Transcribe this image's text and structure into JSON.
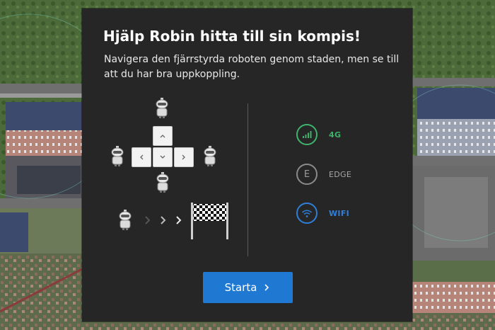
{
  "dialog": {
    "title": "Hjälp Robin hitta till sin kompis!",
    "description": "Navigera den fjärrstyrda roboten genom staden, men se till att du har bra uppkoppling."
  },
  "controls": {
    "icons": [
      "robot-icon",
      "chevron-up-icon",
      "chevron-left-icon",
      "chevron-down-icon",
      "chevron-right-icon",
      "checkered-flag-icon"
    ]
  },
  "network": [
    {
      "id": "4g",
      "label": "4G",
      "icon": "signal-bars-icon",
      "color": "#3fb26b",
      "symbol": ""
    },
    {
      "id": "edge",
      "label": "EDGE",
      "icon": "edge-letter-icon",
      "color": "#8a8a8a",
      "symbol": "E"
    },
    {
      "id": "wifi",
      "label": "WIFI",
      "icon": "wifi-icon",
      "color": "#2f7fd8",
      "symbol": ""
    }
  ],
  "actions": {
    "start_label": "Starta",
    "start_color": "#1f78d1"
  }
}
